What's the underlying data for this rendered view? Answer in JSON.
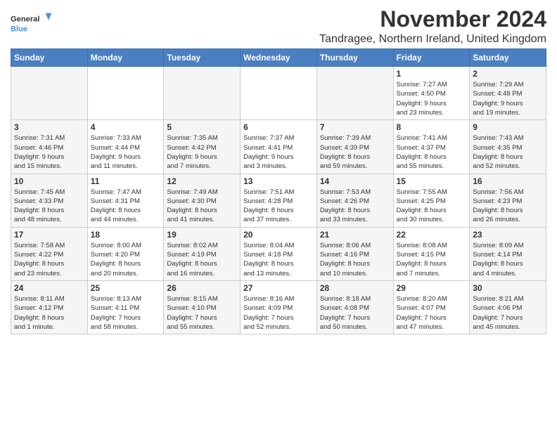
{
  "header": {
    "logo_line1": "General",
    "logo_line2": "Blue",
    "month_title": "November 2024",
    "location": "Tandragee, Northern Ireland, United Kingdom"
  },
  "weekdays": [
    "Sunday",
    "Monday",
    "Tuesday",
    "Wednesday",
    "Thursday",
    "Friday",
    "Saturday"
  ],
  "weeks": [
    [
      {
        "day": "",
        "info": ""
      },
      {
        "day": "",
        "info": ""
      },
      {
        "day": "",
        "info": ""
      },
      {
        "day": "",
        "info": ""
      },
      {
        "day": "",
        "info": ""
      },
      {
        "day": "1",
        "info": "Sunrise: 7:27 AM\nSunset: 4:50 PM\nDaylight: 9 hours\nand 23 minutes."
      },
      {
        "day": "2",
        "info": "Sunrise: 7:29 AM\nSunset: 4:48 PM\nDaylight: 9 hours\nand 19 minutes."
      }
    ],
    [
      {
        "day": "3",
        "info": "Sunrise: 7:31 AM\nSunset: 4:46 PM\nDaylight: 9 hours\nand 15 minutes."
      },
      {
        "day": "4",
        "info": "Sunrise: 7:33 AM\nSunset: 4:44 PM\nDaylight: 9 hours\nand 11 minutes."
      },
      {
        "day": "5",
        "info": "Sunrise: 7:35 AM\nSunset: 4:42 PM\nDaylight: 9 hours\nand 7 minutes."
      },
      {
        "day": "6",
        "info": "Sunrise: 7:37 AM\nSunset: 4:41 PM\nDaylight: 9 hours\nand 3 minutes."
      },
      {
        "day": "7",
        "info": "Sunrise: 7:39 AM\nSunset: 4:39 PM\nDaylight: 8 hours\nand 59 minutes."
      },
      {
        "day": "8",
        "info": "Sunrise: 7:41 AM\nSunset: 4:37 PM\nDaylight: 8 hours\nand 55 minutes."
      },
      {
        "day": "9",
        "info": "Sunrise: 7:43 AM\nSunset: 4:35 PM\nDaylight: 8 hours\nand 52 minutes."
      }
    ],
    [
      {
        "day": "10",
        "info": "Sunrise: 7:45 AM\nSunset: 4:33 PM\nDaylight: 8 hours\nand 48 minutes."
      },
      {
        "day": "11",
        "info": "Sunrise: 7:47 AM\nSunset: 4:31 PM\nDaylight: 8 hours\nand 44 minutes."
      },
      {
        "day": "12",
        "info": "Sunrise: 7:49 AM\nSunset: 4:30 PM\nDaylight: 8 hours\nand 41 minutes."
      },
      {
        "day": "13",
        "info": "Sunrise: 7:51 AM\nSunset: 4:28 PM\nDaylight: 8 hours\nand 37 minutes."
      },
      {
        "day": "14",
        "info": "Sunrise: 7:53 AM\nSunset: 4:26 PM\nDaylight: 8 hours\nand 33 minutes."
      },
      {
        "day": "15",
        "info": "Sunrise: 7:55 AM\nSunset: 4:25 PM\nDaylight: 8 hours\nand 30 minutes."
      },
      {
        "day": "16",
        "info": "Sunrise: 7:56 AM\nSunset: 4:23 PM\nDaylight: 8 hours\nand 26 minutes."
      }
    ],
    [
      {
        "day": "17",
        "info": "Sunrise: 7:58 AM\nSunset: 4:22 PM\nDaylight: 8 hours\nand 23 minutes."
      },
      {
        "day": "18",
        "info": "Sunrise: 8:00 AM\nSunset: 4:20 PM\nDaylight: 8 hours\nand 20 minutes."
      },
      {
        "day": "19",
        "info": "Sunrise: 8:02 AM\nSunset: 4:19 PM\nDaylight: 8 hours\nand 16 minutes."
      },
      {
        "day": "20",
        "info": "Sunrise: 8:04 AM\nSunset: 4:18 PM\nDaylight: 8 hours\nand 13 minutes."
      },
      {
        "day": "21",
        "info": "Sunrise: 8:06 AM\nSunset: 4:16 PM\nDaylight: 8 hours\nand 10 minutes."
      },
      {
        "day": "22",
        "info": "Sunrise: 8:08 AM\nSunset: 4:15 PM\nDaylight: 8 hours\nand 7 minutes."
      },
      {
        "day": "23",
        "info": "Sunrise: 8:09 AM\nSunset: 4:14 PM\nDaylight: 8 hours\nand 4 minutes."
      }
    ],
    [
      {
        "day": "24",
        "info": "Sunrise: 8:11 AM\nSunset: 4:12 PM\nDaylight: 8 hours\nand 1 minute."
      },
      {
        "day": "25",
        "info": "Sunrise: 8:13 AM\nSunset: 4:11 PM\nDaylight: 7 hours\nand 58 minutes."
      },
      {
        "day": "26",
        "info": "Sunrise: 8:15 AM\nSunset: 4:10 PM\nDaylight: 7 hours\nand 55 minutes."
      },
      {
        "day": "27",
        "info": "Sunrise: 8:16 AM\nSunset: 4:09 PM\nDaylight: 7 hours\nand 52 minutes."
      },
      {
        "day": "28",
        "info": "Sunrise: 8:18 AM\nSunset: 4:08 PM\nDaylight: 7 hours\nand 50 minutes."
      },
      {
        "day": "29",
        "info": "Sunrise: 8:20 AM\nSunset: 4:07 PM\nDaylight: 7 hours\nand 47 minutes."
      },
      {
        "day": "30",
        "info": "Sunrise: 8:21 AM\nSunset: 4:06 PM\nDaylight: 7 hours\nand 45 minutes."
      }
    ]
  ]
}
